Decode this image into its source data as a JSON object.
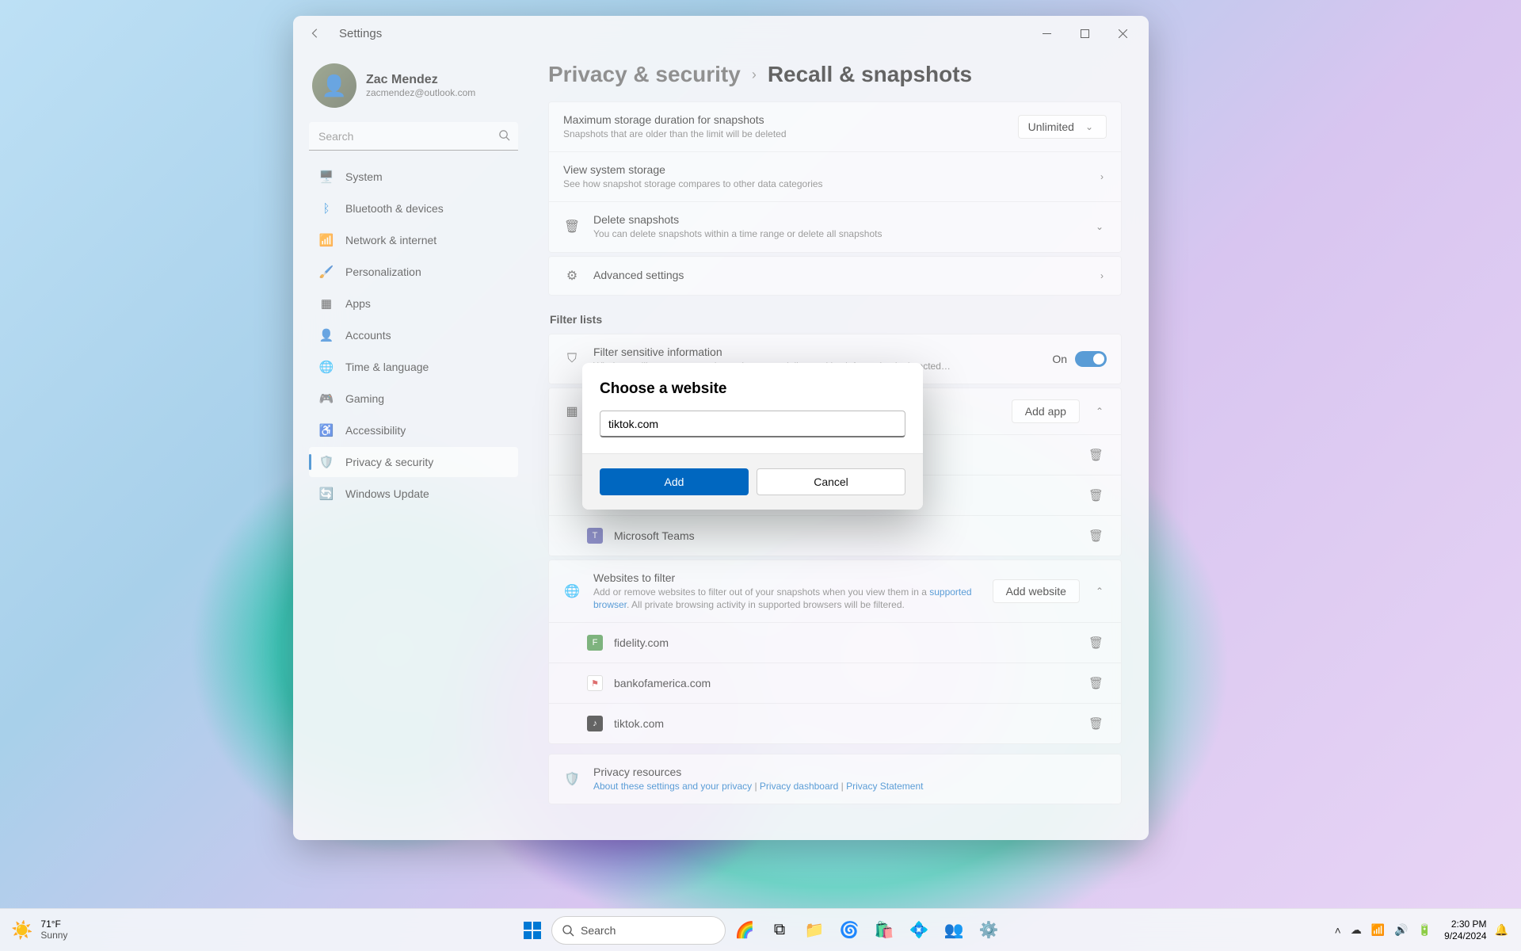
{
  "window": {
    "title": "Settings",
    "profile_name": "Zac Mendez",
    "profile_email": "zacmendez@outlook.com",
    "search_placeholder": "Search"
  },
  "nav": {
    "items": [
      {
        "label": "System"
      },
      {
        "label": "Bluetooth & devices"
      },
      {
        "label": "Network & internet"
      },
      {
        "label": "Personalization"
      },
      {
        "label": "Apps"
      },
      {
        "label": "Accounts"
      },
      {
        "label": "Time & language"
      },
      {
        "label": "Gaming"
      },
      {
        "label": "Accessibility"
      },
      {
        "label": "Privacy & security"
      },
      {
        "label": "Windows Update"
      }
    ]
  },
  "breadcrumb": {
    "parent": "Privacy & security",
    "current": "Recall & snapshots"
  },
  "storage": {
    "max_title": "Maximum storage duration for snapshots",
    "max_desc": "Snapshots that are older than the limit will be deleted",
    "max_value": "Unlimited",
    "view_title": "View system storage",
    "view_desc": "See how snapshot storage compares to other data categories",
    "delete_title": "Delete snapshots",
    "delete_desc": "You can delete snapshots within a time range or delete all snapshots",
    "advanced": "Advanced settings"
  },
  "filter": {
    "section": "Filter lists",
    "sense_title": "Filter sensitive information",
    "sense_desc": "Windows will not save snapshots when potentially sensitive information is detected…",
    "sense_state": "On",
    "apps_add": "Add app",
    "apps": [
      {
        "label": "Microsoft Teams"
      }
    ],
    "web_title": "Websites to filter",
    "web_desc_pre": "Add or remove websites to filter out of your snapshots when you view them in a ",
    "web_desc_link": "supported browser",
    "web_desc_post": ". All private browsing activity in supported browsers will be filtered.",
    "web_add": "Add website",
    "websites": [
      {
        "label": "fidelity.com",
        "bg": "#3a8a3a"
      },
      {
        "label": "bankofamerica.com",
        "bg": "#ffffff"
      },
      {
        "label": "tiktok.com",
        "bg": "#111111"
      }
    ],
    "privacy_title": "Privacy resources",
    "privacy_links": [
      "About these settings and your privacy",
      "Privacy dashboard",
      "Privacy Statement"
    ]
  },
  "dialog": {
    "title": "Choose a website",
    "value": "tiktok.com",
    "add": "Add",
    "cancel": "Cancel"
  },
  "taskbar": {
    "temp": "71°F",
    "cond": "Sunny",
    "search": "Search",
    "time": "2:30 PM",
    "date": "9/24/2024"
  }
}
